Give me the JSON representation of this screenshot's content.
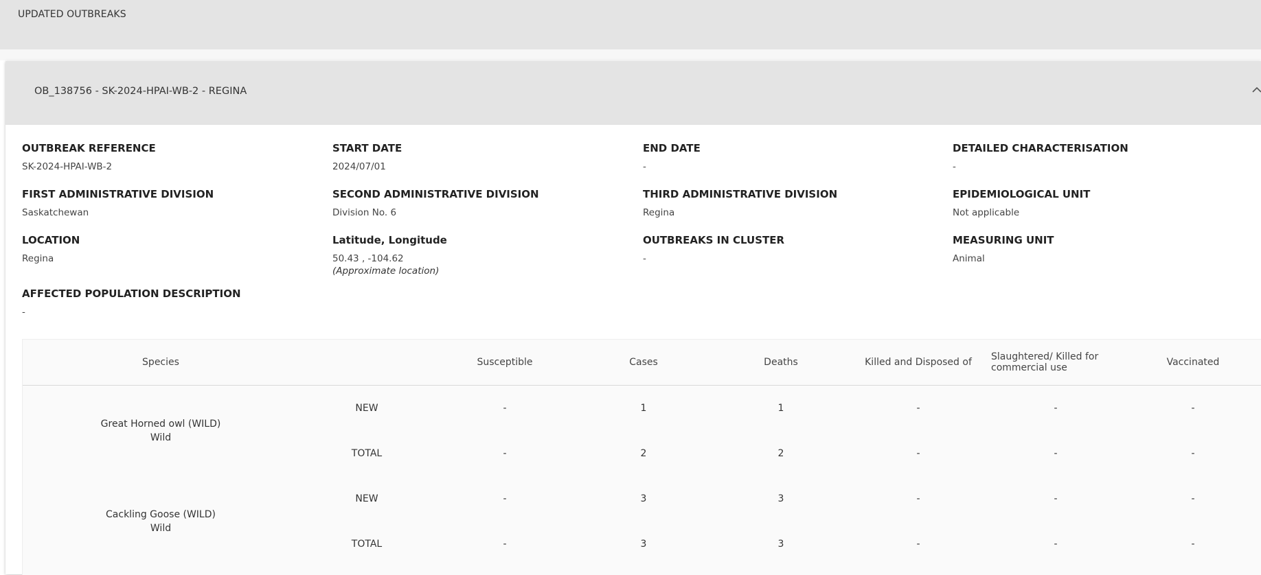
{
  "page": {
    "section_title": "UPDATED OUTBREAKS"
  },
  "outbreak": {
    "header_title": "OB_138756 - SK-2024-HPAI-WB-2 - REGINA",
    "fields": {
      "outbreak_reference": {
        "label": "OUTBREAK REFERENCE",
        "value": "SK-2024-HPAI-WB-2"
      },
      "start_date": {
        "label": "START DATE",
        "value": "2024/07/01"
      },
      "end_date": {
        "label": "END DATE",
        "value": "-"
      },
      "detailed_characterisation": {
        "label": "DETAILED CHARACTERISATION",
        "value": "-"
      },
      "first_admin_division": {
        "label": "FIRST ADMINISTRATIVE DIVISION",
        "value": "Saskatchewan"
      },
      "second_admin_division": {
        "label": "SECOND ADMINISTRATIVE DIVISION",
        "value": "Division No. 6"
      },
      "third_admin_division": {
        "label": "THIRD ADMINISTRATIVE DIVISION",
        "value": "Regina"
      },
      "epidemiological_unit": {
        "label": "EPIDEMIOLOGICAL UNIT",
        "value": "Not applicable"
      },
      "location": {
        "label": "LOCATION",
        "value": "Regina"
      },
      "lat_long": {
        "label": "Latitude, Longitude",
        "value": "50.43 , -104.62",
        "note": "(Approximate location)"
      },
      "outbreaks_in_cluster": {
        "label": "OUTBREAKS IN CLUSTER",
        "value": "-"
      },
      "measuring_unit": {
        "label": "MEASURING UNIT",
        "value": "Animal"
      },
      "affected_population": {
        "label": "AFFECTED POPULATION DESCRIPTION",
        "value": "-"
      }
    }
  },
  "species_table": {
    "headers": {
      "species": "Species",
      "type": "",
      "susceptible": "Susceptible",
      "cases": "Cases",
      "deaths": "Deaths",
      "killed": "Killed and Disposed of",
      "slaughtered": "Slaughtered/ Killed for commercial use",
      "vaccinated": "Vaccinated"
    },
    "rows": [
      {
        "species": "Great Horned owl (WILD)",
        "category": "Wild",
        "new": {
          "label": "NEW",
          "susceptible": "-",
          "cases": "1",
          "deaths": "1",
          "killed": "-",
          "slaughtered": "-",
          "vaccinated": "-"
        },
        "total": {
          "label": "TOTAL",
          "susceptible": "-",
          "cases": "2",
          "deaths": "2",
          "killed": "-",
          "slaughtered": "-",
          "vaccinated": "-"
        }
      },
      {
        "species": "Cackling Goose (WILD)",
        "category": "Wild",
        "new": {
          "label": "NEW",
          "susceptible": "-",
          "cases": "3",
          "deaths": "3",
          "killed": "-",
          "slaughtered": "-",
          "vaccinated": "-"
        },
        "total": {
          "label": "TOTAL",
          "susceptible": "-",
          "cases": "3",
          "deaths": "3",
          "killed": "-",
          "slaughtered": "-",
          "vaccinated": "-"
        }
      }
    ]
  },
  "colors": {
    "header_bg": "#e4e4e4",
    "table_bg": "#fafafa",
    "text": "#222222"
  }
}
